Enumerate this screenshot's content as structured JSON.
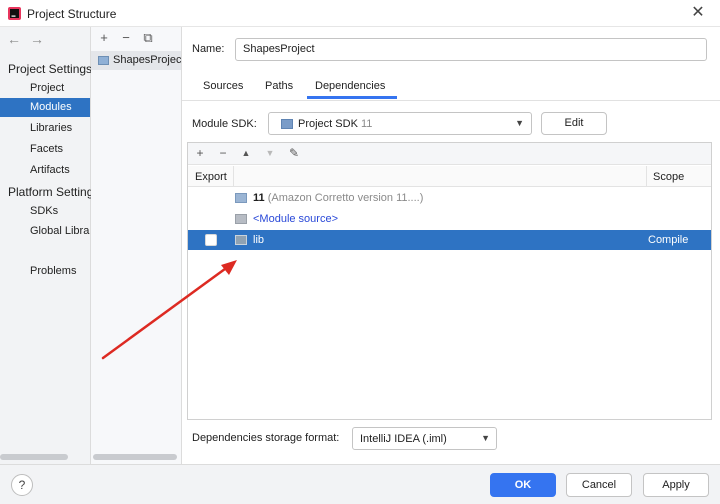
{
  "window": {
    "title": "Project Structure",
    "close_symbol": "✕"
  },
  "nav": {
    "back": "←",
    "forward": "→"
  },
  "sidebar": {
    "project_settings_title": "Project Settings",
    "project_items": [
      {
        "label": "Project"
      },
      {
        "label": "Modules",
        "selected": true
      },
      {
        "label": "Libraries"
      },
      {
        "label": "Facets"
      },
      {
        "label": "Artifacts"
      }
    ],
    "platform_settings_title": "Platform Settings",
    "platform_items": [
      {
        "label": "SDKs"
      },
      {
        "label": "Global Libraries"
      }
    ],
    "problems_label": "Problems"
  },
  "modules": {
    "toolbar": {
      "add": "+",
      "remove": "−",
      "copy": "⧉"
    },
    "items": [
      {
        "label": "ShapesProject"
      }
    ]
  },
  "module_settings": {
    "name_label": "Name:",
    "name_value": "ShapesProject",
    "tabs": [
      {
        "label": "Sources"
      },
      {
        "label": "Paths"
      },
      {
        "label": "Dependencies",
        "active": true
      }
    ],
    "sdk_label": "Module SDK:",
    "sdk_name": "Project SDK",
    "sdk_version": "11",
    "edit_label": "Edit"
  },
  "dependencies": {
    "toolbar": {
      "add": "+",
      "remove": "−",
      "move_up": "▲",
      "move_down": "▼",
      "edit": "✎"
    },
    "columns": {
      "export": "Export",
      "scope": "Scope"
    },
    "rows": {
      "jdk": {
        "name": "11",
        "detail": "(Amazon Corretto version 11....)"
      },
      "source": {
        "name": "<Module source>"
      },
      "lib": {
        "name": "lib",
        "scope": "Compile",
        "selected": true,
        "exported": false
      }
    }
  },
  "storage": {
    "label": "Dependencies storage format:",
    "value": "IntelliJ IDEA (.iml)"
  },
  "footer": {
    "help": "?",
    "ok": "OK",
    "cancel": "Cancel",
    "apply": "Apply"
  },
  "colors": {
    "selection": "#2e73c3",
    "primary_button": "#3574f0",
    "annotation_arrow": "#dd2a22"
  }
}
